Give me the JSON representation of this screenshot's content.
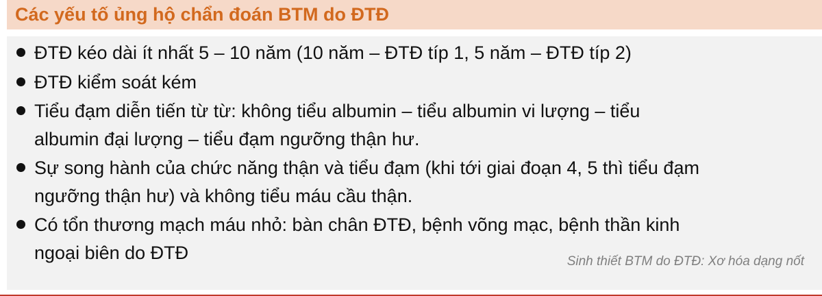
{
  "title": "Các yếu tố ủng hộ chẩn đoán BTM do ĐTĐ",
  "bullets": [
    {
      "lines": [
        "ĐTĐ kéo dài ít nhất 5 – 10 năm (10 năm – ĐTĐ típ 1, 5 năm – ĐTĐ típ 2)"
      ]
    },
    {
      "lines": [
        "ĐTĐ kiểm soát kém"
      ]
    },
    {
      "lines": [
        "Tiểu đạm diễn tiến từ từ: không tiểu albumin – tiểu albumin vi lượng – tiểu",
        "albumin đại lượng – tiểu đạm ngưỡng thận hư."
      ]
    },
    {
      "lines": [
        "Sự song hành của chức năng thận và tiểu đạm (khi tới giai đoạn 4, 5 thì tiểu đạm",
        "ngưỡng thận hư) và không tiểu máu cầu thận."
      ]
    },
    {
      "lines": [
        "Có tổn thương mạch máu nhỏ: bàn chân ĐTĐ, bệnh võng mạc, bệnh thần kinh",
        "ngoại biên do ĐTĐ"
      ]
    }
  ],
  "caption": "Sinh thiết BTM do ĐTĐ: Xơ hóa dạng nốt",
  "colors": {
    "title": "#d2691e",
    "header_band": "#f6d9c8",
    "body_box": "#f2f2f2",
    "text": "#111111",
    "caption": "#7f7f7f",
    "bottom_rule": "#c0392b"
  }
}
